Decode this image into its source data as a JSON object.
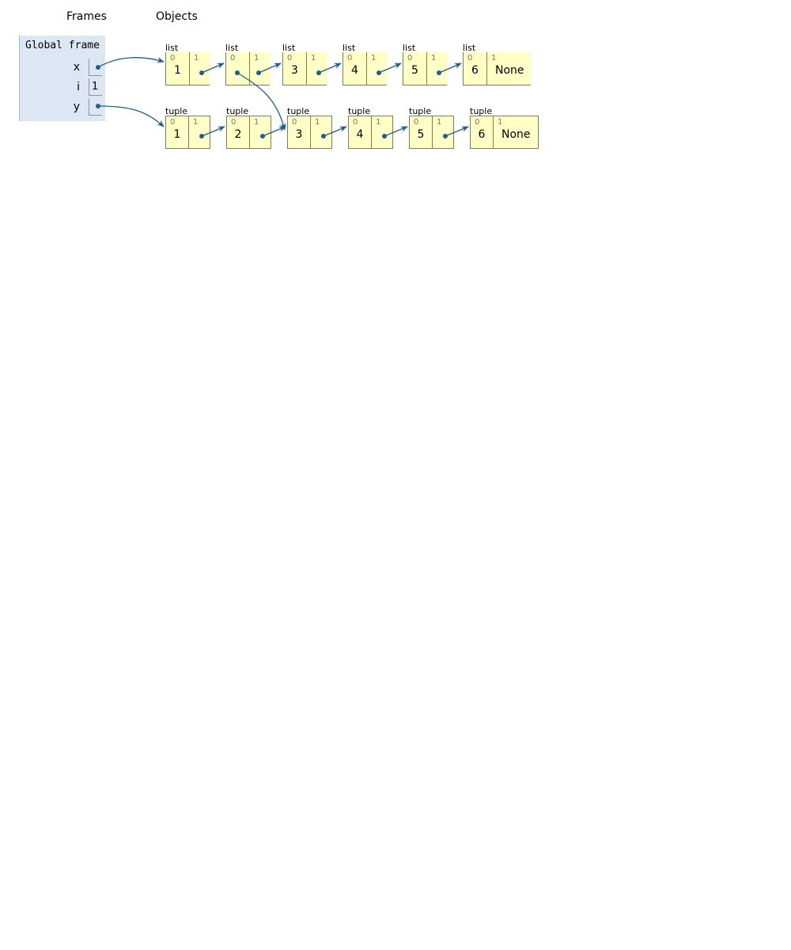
{
  "headings": {
    "frames": "Frames",
    "objects": "Objects"
  },
  "frame": {
    "title": "Global frame",
    "vars": [
      {
        "name": "x",
        "value": ""
      },
      {
        "name": "i",
        "value": "1"
      },
      {
        "name": "y",
        "value": ""
      }
    ]
  },
  "lists": [
    {
      "type": "list",
      "idx0": "0",
      "idx1": "1",
      "first": "1",
      "rest": ""
    },
    {
      "type": "list",
      "idx0": "0",
      "idx1": "1",
      "first": "",
      "rest": ""
    },
    {
      "type": "list",
      "idx0": "0",
      "idx1": "1",
      "first": "3",
      "rest": ""
    },
    {
      "type": "list",
      "idx0": "0",
      "idx1": "1",
      "first": "4",
      "rest": ""
    },
    {
      "type": "list",
      "idx0": "0",
      "idx1": "1",
      "first": "5",
      "rest": ""
    },
    {
      "type": "list",
      "idx0": "0",
      "idx1": "1",
      "first": "6",
      "rest": "None"
    }
  ],
  "tuples": [
    {
      "type": "tuple",
      "idx0": "0",
      "idx1": "1",
      "first": "1",
      "rest": ""
    },
    {
      "type": "tuple",
      "idx0": "0",
      "idx1": "1",
      "first": "2",
      "rest": ""
    },
    {
      "type": "tuple",
      "idx0": "0",
      "idx1": "1",
      "first": "3",
      "rest": ""
    },
    {
      "type": "tuple",
      "idx0": "0",
      "idx1": "1",
      "first": "4",
      "rest": ""
    },
    {
      "type": "tuple",
      "idx0": "0",
      "idx1": "1",
      "first": "5",
      "rest": ""
    },
    {
      "type": "tuple",
      "idx0": "0",
      "idx1": "1",
      "first": "6",
      "rest": "None"
    }
  ],
  "colors": {
    "arrow": "#1f5f8b",
    "cell": "#ffffc6",
    "frame": "#dde6f3"
  }
}
